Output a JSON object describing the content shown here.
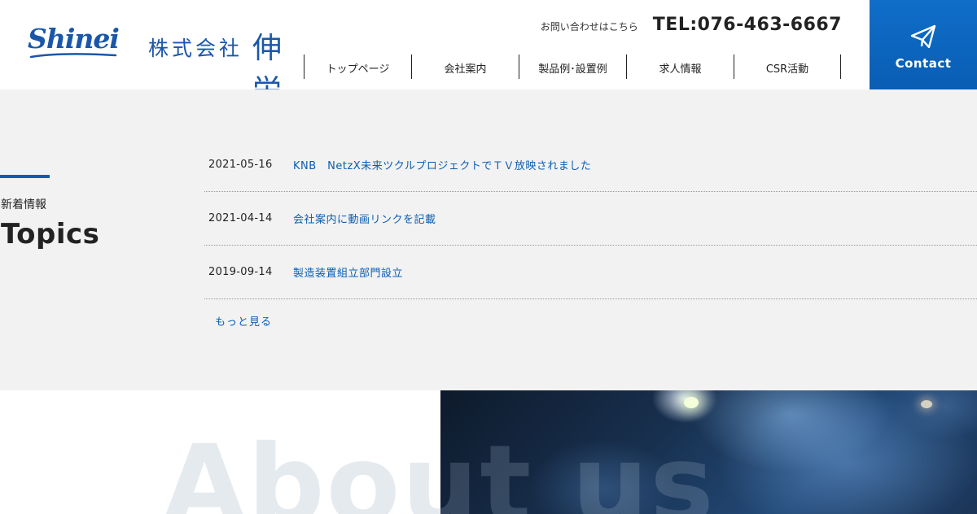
{
  "header": {
    "logo": {
      "script": "Shinei",
      "company_prefix": "株式会社",
      "company_name": "伸栄"
    },
    "contact_label": "お問い合わせはこちら",
    "tel": "TEL:076-463-6667",
    "nav": [
      {
        "label": "トップページ"
      },
      {
        "label": "会社案内"
      },
      {
        "label": "製品例･設置例"
      },
      {
        "label": "求人情報"
      },
      {
        "label": "CSR活動"
      }
    ],
    "contact_button": "Contact"
  },
  "topics": {
    "subtitle": "新着情報",
    "title": "Topics",
    "items": [
      {
        "date": "2021-05-16",
        "title": "KNB　NetzX未来ツクルプロジェクトでＴＶ放映されました"
      },
      {
        "date": "2021-04-14",
        "title": "会社案内に動画リンクを記載"
      },
      {
        "date": "2019-09-14",
        "title": "製造装置組立部門設立"
      }
    ],
    "more": "もっと見る"
  },
  "about": {
    "heading": "About us"
  },
  "colors": {
    "brand_blue": "#0a5db3",
    "section_gray": "#f2f2f2"
  }
}
